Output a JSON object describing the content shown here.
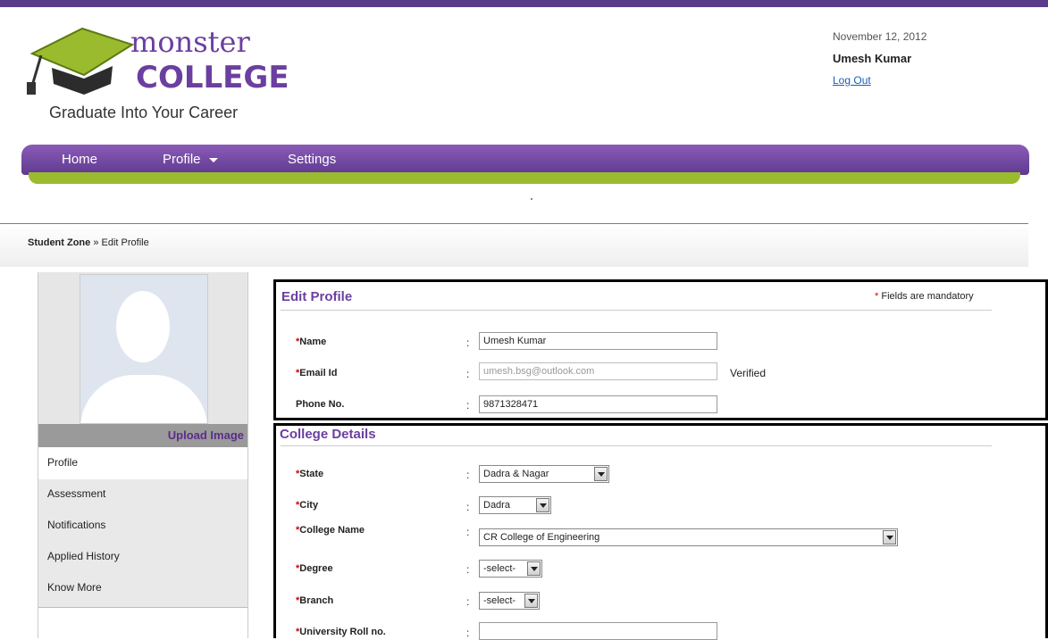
{
  "header": {
    "logo_word1": "monster",
    "logo_word2": "COLLEGE",
    "tagline": "Graduate Into Your Career",
    "date": "November 12, 2012",
    "user_name": "Umesh Kumar",
    "logout": "Log Out"
  },
  "nav": {
    "items": [
      "Home",
      "Profile",
      "Settings"
    ]
  },
  "breadcrumb": {
    "root": "Student Zone",
    "sep": " » ",
    "current": "Edit Profile"
  },
  "sidebar": {
    "upload_label": "Upload Image",
    "items": [
      "Profile",
      "Assessment",
      "Notifications",
      "Applied History",
      "Know More"
    ]
  },
  "edit_profile": {
    "title": "Edit Profile",
    "mandatory_note": "Fields are mandatory",
    "name_label": "Name",
    "name_value": "Umesh Kumar",
    "email_label": "Email Id",
    "email_value": "umesh.bsg@outlook.com",
    "email_status": "Verified",
    "phone_label": "Phone No.",
    "phone_value": "9871328471"
  },
  "college": {
    "title": "College Details",
    "state_label": "State",
    "state_value": "Dadra & Nagar",
    "city_label": "City",
    "city_value": "Dadra",
    "college_label": "College Name",
    "college_value": "CR College of Engineering",
    "degree_label": "Degree",
    "degree_value": "-select-",
    "branch_label": "Branch",
    "branch_value": "-select-",
    "roll_label": "University Roll no.",
    "roll_value": ""
  },
  "colors": {
    "purple": "#5b3c88",
    "green": "#9bbb2e",
    "required": "#d40000"
  }
}
